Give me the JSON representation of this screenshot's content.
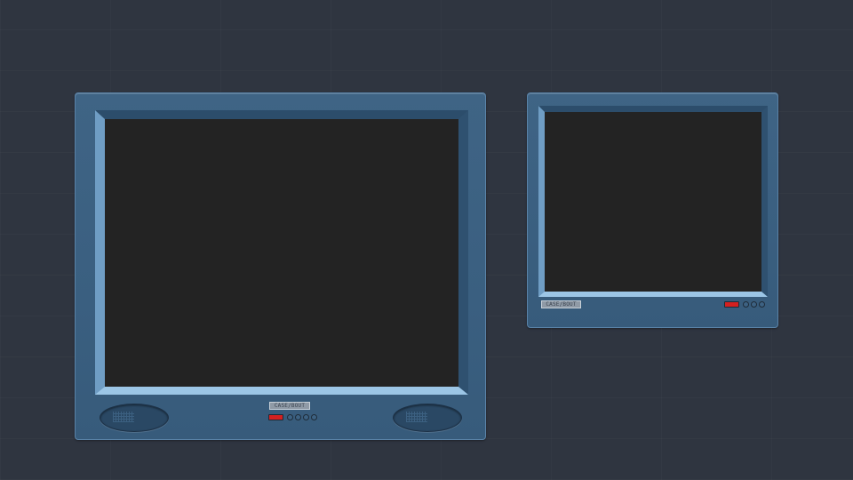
{
  "monitors": [
    {
      "brand_label": "CASE/BOUT",
      "power_led_color": "#d42020",
      "button_count": 4,
      "speakers": 2
    },
    {
      "brand_label": "CASE/BOUT",
      "power_led_color": "#d42020",
      "button_count": 3,
      "speakers": 0
    }
  ],
  "colors": {
    "background": "#2f3540",
    "case": "#3a5f80",
    "screen": "#232323"
  }
}
